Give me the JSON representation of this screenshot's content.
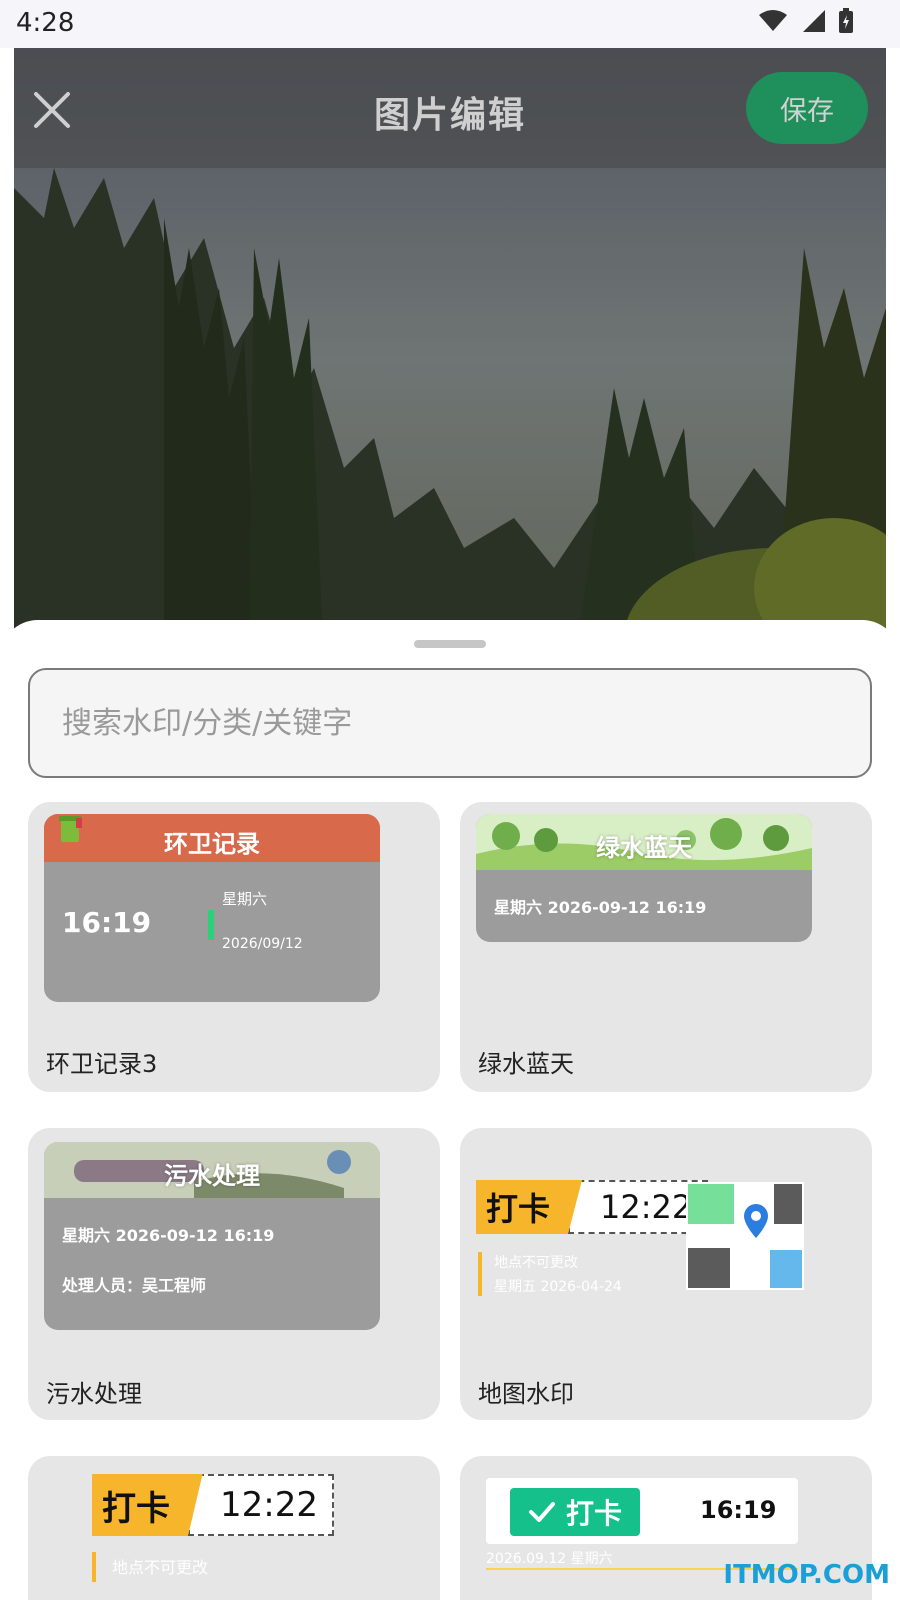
{
  "status_bar": {
    "time": "4:28"
  },
  "editor": {
    "title": "图片编辑",
    "save_label": "保存"
  },
  "search": {
    "placeholder": "搜索水印/分类/关键字",
    "value": ""
  },
  "cards": [
    {
      "label": "环卫记录3",
      "banner": "环卫记录",
      "time": "16:19",
      "weekday": "星期六",
      "date": "2026/09/12",
      "banner_color": "#d9694b"
    },
    {
      "label": "绿水蓝天",
      "banner": "绿水蓝天",
      "line": "星期六 2026-09-12 16:19"
    },
    {
      "label": "污水处理",
      "banner": "污水处理",
      "line1": "星期六 2026-09-12 16:19",
      "line2": "处理人员：吴工程师"
    },
    {
      "label": "地图水印",
      "badge_left": "打卡",
      "badge_time": "12:22",
      "location_note": "地点不可更改",
      "date_line": "星期五 2026-04-24"
    },
    {
      "badge_left": "打卡",
      "badge_time": "12:22",
      "location_note": "地点不可更改"
    },
    {
      "check_label": "打卡",
      "time": "16:19",
      "date_line": "2026.09.12 星期六"
    }
  ],
  "site_watermark": "ITMOP.COM",
  "colors": {
    "save": "#1f8f5c",
    "accent_green": "#16c08a",
    "badge_yellow": "#f7b52b"
  }
}
